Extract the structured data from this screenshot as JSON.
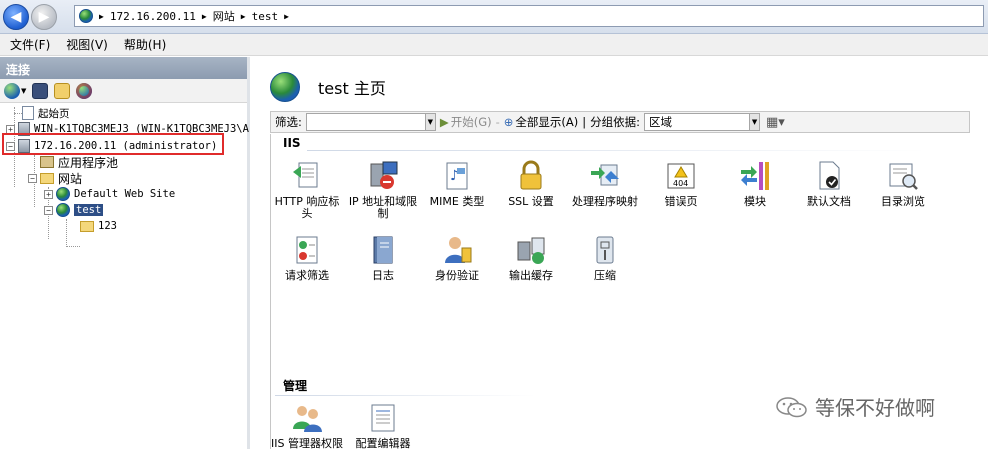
{
  "address": {
    "crumbs": [
      "172.16.200.11",
      "网站",
      "test"
    ]
  },
  "menu": [
    "文件(F)",
    "视图(V)",
    "帮助(H)"
  ],
  "connections": {
    "header": "连接",
    "tree": {
      "start_page": "起始页",
      "host_win": "WIN-K1TQBC3MEJ3 (WIN-K1TQBC3MEJ3\\A",
      "host_ip": "172.16.200.11 (administrator)",
      "app_pools": "应用程序池",
      "sites": "网站",
      "default_site": "Default Web Site",
      "test_site": "test",
      "folder_123": "123"
    }
  },
  "main": {
    "title": "test 主页",
    "filter": {
      "label": "筛选:",
      "start": "开始(G)",
      "show_all": "全部显示(A)",
      "group_by": "分组依据:",
      "group_value": "区域"
    },
    "sections": {
      "iis": "IIS",
      "manage": "管理"
    },
    "features_iis_row1": [
      {
        "label": "HTTP 响应标头",
        "icon": "http-response-headers-icon"
      },
      {
        "label": "IP 地址和域限制",
        "icon": "ip-domain-restrictions-icon"
      },
      {
        "label": "MIME 类型",
        "icon": "mime-types-icon"
      },
      {
        "label": "SSL 设置",
        "icon": "ssl-settings-icon"
      },
      {
        "label": "处理程序映射",
        "icon": "handler-mappings-icon"
      },
      {
        "label": "错误页",
        "icon": "error-pages-icon"
      },
      {
        "label": "模块",
        "icon": "modules-icon"
      },
      {
        "label": "默认文档",
        "icon": "default-document-icon"
      },
      {
        "label": "目录浏览",
        "icon": "directory-browsing-icon"
      }
    ],
    "features_iis_row2": [
      {
        "label": "请求筛选",
        "icon": "request-filtering-icon"
      },
      {
        "label": "日志",
        "icon": "logging-icon"
      },
      {
        "label": "身份验证",
        "icon": "authentication-icon"
      },
      {
        "label": "输出缓存",
        "icon": "output-caching-icon"
      },
      {
        "label": "压缩",
        "icon": "compression-icon"
      }
    ],
    "features_manage": [
      {
        "label": "IIS 管理器权限",
        "icon": "iis-manager-permissions-icon"
      },
      {
        "label": "配置编辑器",
        "icon": "configuration-editor-icon"
      }
    ],
    "error_icon_text": "404"
  },
  "watermark": "等保不好做啊",
  "colors": {
    "selection": "#2d4e86",
    "highlight_box": "#e02b2b",
    "connections_header": "#8c9bb0"
  }
}
